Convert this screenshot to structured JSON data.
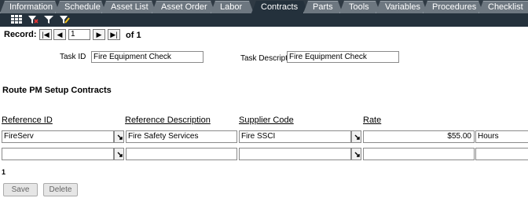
{
  "tabs": [
    {
      "label": "Information",
      "active": false
    },
    {
      "label": "Schedule",
      "active": false
    },
    {
      "label": "Asset List",
      "active": false
    },
    {
      "label": "Asset Order",
      "active": false
    },
    {
      "label": "Labor",
      "active": false
    },
    {
      "label": "Contracts",
      "active": true
    },
    {
      "label": "Parts",
      "active": false
    },
    {
      "label": "Tools",
      "active": false
    },
    {
      "label": "Variables",
      "active": false
    },
    {
      "label": "Procedures",
      "active": false
    },
    {
      "label": "Checklist",
      "active": false
    }
  ],
  "toolbar": {
    "icons": [
      "grid-icon",
      "filter-clear-icon",
      "filter-icon",
      "filter-edit-icon"
    ]
  },
  "record": {
    "label": "Record:",
    "current": "1",
    "of_text": "of 1",
    "first": "|◀",
    "prev": "◀",
    "next": "▶",
    "last": "▶|"
  },
  "task": {
    "id_label": "Task ID",
    "id_value": "Fire Equipment Check",
    "desc_label": "Task Description",
    "desc_value": "Fire Equipment Check"
  },
  "section": {
    "title": "Route PM Setup Contracts"
  },
  "grid": {
    "headers": {
      "reference_id": "Reference ID",
      "reference_description": "Reference Description",
      "supplier_code": "Supplier Code",
      "rate": "Rate"
    },
    "rows": [
      {
        "reference_id": "FireServ",
        "reference_description": "Fire Safety Services",
        "supplier_code": "Fire SSCI",
        "rate": "$55.00",
        "unit": "Hours"
      },
      {
        "reference_id": "",
        "reference_description": "",
        "supplier_code": "",
        "rate": "",
        "unit": ""
      }
    ]
  },
  "pager": {
    "page": "1"
  },
  "actions": {
    "save": "Save",
    "delete": "Delete"
  }
}
